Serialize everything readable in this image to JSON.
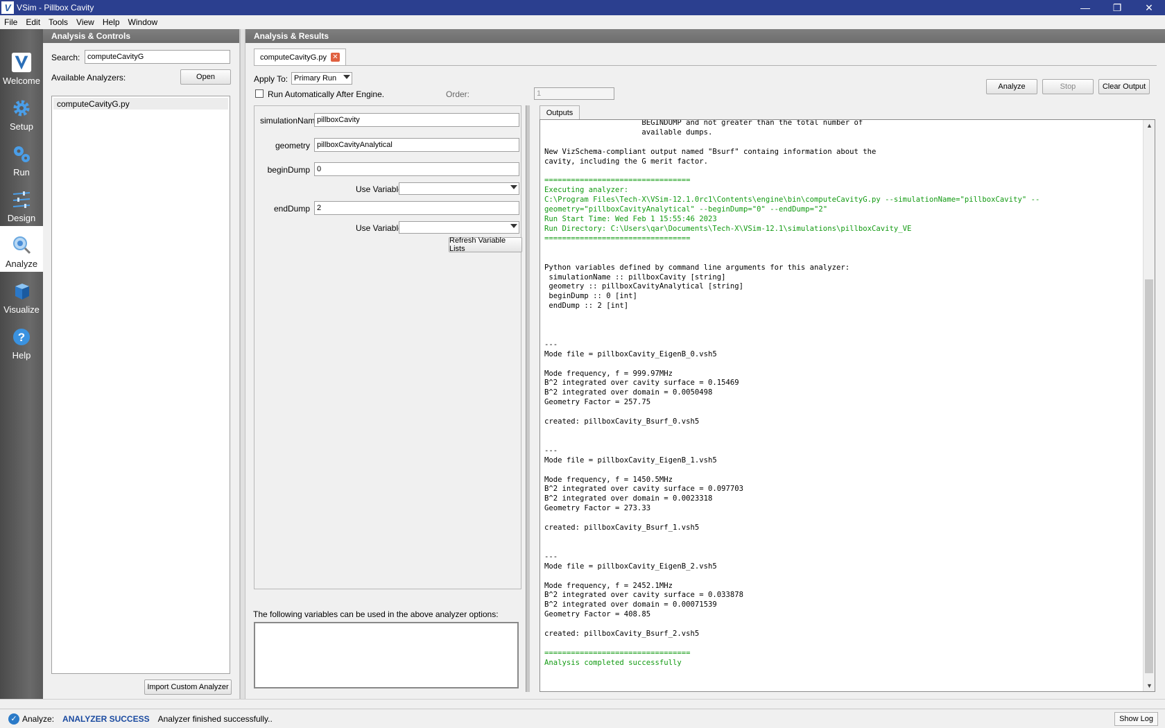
{
  "window": {
    "title": "VSim - Pillbox Cavity",
    "minimize_glyph": "—",
    "restore_glyph": "❐",
    "close_glyph": "✕"
  },
  "menu": [
    "File",
    "Edit",
    "Tools",
    "View",
    "Help",
    "Window"
  ],
  "nav": [
    {
      "label": "Welcome",
      "icon": "vsim-logo-icon"
    },
    {
      "label": "Setup",
      "icon": "gear-icon"
    },
    {
      "label": "Run",
      "icon": "gears-icon"
    },
    {
      "label": "Design",
      "icon": "sliders-icon"
    },
    {
      "label": "Analyze",
      "icon": "magnifier-icon",
      "active": true
    },
    {
      "label": "Visualize",
      "icon": "cube-icon"
    },
    {
      "label": "Help",
      "icon": "question-icon"
    }
  ],
  "left_panel": {
    "header": "Analysis & Controls",
    "search_label": "Search:",
    "search_value": "computeCavityG",
    "available_label": "Available Analyzers:",
    "open_button": "Open",
    "analyzers": [
      "computeCavityG.py"
    ],
    "import_button": "Import Custom Analyzer"
  },
  "right_panel": {
    "header": "Analysis & Results",
    "tab_label": "computeCavityG.py",
    "apply_to_label": "Apply To:",
    "apply_to_value": "Primary Run",
    "run_auto_label": "Run Automatically After Engine.",
    "order_label": "Order:",
    "order_value": "1",
    "analyze_button": "Analyze",
    "stop_button": "Stop",
    "clear_button": "Clear Output",
    "fields": {
      "simulationName": {
        "label": "simulationName",
        "value": "pillboxCavity"
      },
      "geometry": {
        "label": "geometry",
        "value": "pillboxCavityAnalytical"
      },
      "beginDump": {
        "label": "beginDump",
        "value": "0"
      },
      "endDump": {
        "label": "endDump",
        "value": "2"
      }
    },
    "use_variable_label": "Use Variable:",
    "refresh_button": "Refresh Variable Lists",
    "vars_hint": "The following variables can be used in the above analyzer options:",
    "outputs_tab": "Outputs"
  },
  "output_lines": [
    {
      "t": "                      BEGINDUMP and not greater than the total number of",
      "c": "k"
    },
    {
      "t": "                      available dumps.",
      "c": "k"
    },
    {
      "t": "",
      "c": "k"
    },
    {
      "t": "New VizSchema-compliant output named \"Bsurf\" containg information about the",
      "c": "k"
    },
    {
      "t": "cavity, including the G merit factor.",
      "c": "k"
    },
    {
      "t": "",
      "c": "k"
    },
    {
      "t": "=================================",
      "c": "g"
    },
    {
      "t": "Executing analyzer:",
      "c": "g"
    },
    {
      "t": "C:\\Program Files\\Tech-X\\VSim-12.1.0rc1\\Contents\\engine\\bin\\computeCavityG.py --simulationName=\"pillboxCavity\" --",
      "c": "g"
    },
    {
      "t": "geometry=\"pillboxCavityAnalytical\" --beginDump=\"0\" --endDump=\"2\"",
      "c": "g"
    },
    {
      "t": "Run Start Time: Wed Feb 1 15:55:46 2023",
      "c": "g"
    },
    {
      "t": "Run Directory: C:\\Users\\qar\\Documents\\Tech-X\\VSim-12.1\\simulations\\pillboxCavity_VE",
      "c": "g"
    },
    {
      "t": "=================================",
      "c": "g"
    },
    {
      "t": "",
      "c": "k"
    },
    {
      "t": "",
      "c": "k"
    },
    {
      "t": "Python variables defined by command line arguments for this analyzer:",
      "c": "k"
    },
    {
      "t": " simulationName :: pillboxCavity [string]",
      "c": "k"
    },
    {
      "t": " geometry :: pillboxCavityAnalytical [string]",
      "c": "k"
    },
    {
      "t": " beginDump :: 0 [int]",
      "c": "k"
    },
    {
      "t": " endDump :: 2 [int]",
      "c": "k"
    },
    {
      "t": "",
      "c": "k"
    },
    {
      "t": "",
      "c": "k"
    },
    {
      "t": "",
      "c": "k"
    },
    {
      "t": "---",
      "c": "k"
    },
    {
      "t": "Mode file = pillboxCavity_EigenB_0.vsh5",
      "c": "k"
    },
    {
      "t": "",
      "c": "k"
    },
    {
      "t": "Mode frequency, f = 999.97MHz",
      "c": "k"
    },
    {
      "t": "B^2 integrated over cavity surface = 0.15469",
      "c": "k"
    },
    {
      "t": "B^2 integrated over domain = 0.0050498",
      "c": "k"
    },
    {
      "t": "Geometry Factor = 257.75",
      "c": "k"
    },
    {
      "t": "",
      "c": "k"
    },
    {
      "t": "created: pillboxCavity_Bsurf_0.vsh5",
      "c": "k"
    },
    {
      "t": "",
      "c": "k"
    },
    {
      "t": "",
      "c": "k"
    },
    {
      "t": "---",
      "c": "k"
    },
    {
      "t": "Mode file = pillboxCavity_EigenB_1.vsh5",
      "c": "k"
    },
    {
      "t": "",
      "c": "k"
    },
    {
      "t": "Mode frequency, f = 1450.5MHz",
      "c": "k"
    },
    {
      "t": "B^2 integrated over cavity surface = 0.097703",
      "c": "k"
    },
    {
      "t": "B^2 integrated over domain = 0.0023318",
      "c": "k"
    },
    {
      "t": "Geometry Factor = 273.33",
      "c": "k"
    },
    {
      "t": "",
      "c": "k"
    },
    {
      "t": "created: pillboxCavity_Bsurf_1.vsh5",
      "c": "k"
    },
    {
      "t": "",
      "c": "k"
    },
    {
      "t": "",
      "c": "k"
    },
    {
      "t": "---",
      "c": "k"
    },
    {
      "t": "Mode file = pillboxCavity_EigenB_2.vsh5",
      "c": "k"
    },
    {
      "t": "",
      "c": "k"
    },
    {
      "t": "Mode frequency, f = 2452.1MHz",
      "c": "k"
    },
    {
      "t": "B^2 integrated over cavity surface = 0.033878",
      "c": "k"
    },
    {
      "t": "B^2 integrated over domain = 0.00071539",
      "c": "k"
    },
    {
      "t": "Geometry Factor = 408.85",
      "c": "k"
    },
    {
      "t": "",
      "c": "k"
    },
    {
      "t": "created: pillboxCavity_Bsurf_2.vsh5",
      "c": "k"
    },
    {
      "t": "",
      "c": "k"
    },
    {
      "t": "=================================",
      "c": "g"
    },
    {
      "t": "Analysis completed successfully",
      "c": "g"
    }
  ],
  "status": {
    "label": "Analyze:",
    "state": "ANALYZER SUCCESS",
    "message": "Analyzer finished successfully..",
    "show_log": "Show Log"
  },
  "colors": {
    "titlebar": "#2b3f8f",
    "output_green": "#129a12",
    "status_blue": "#1a4aa0"
  }
}
